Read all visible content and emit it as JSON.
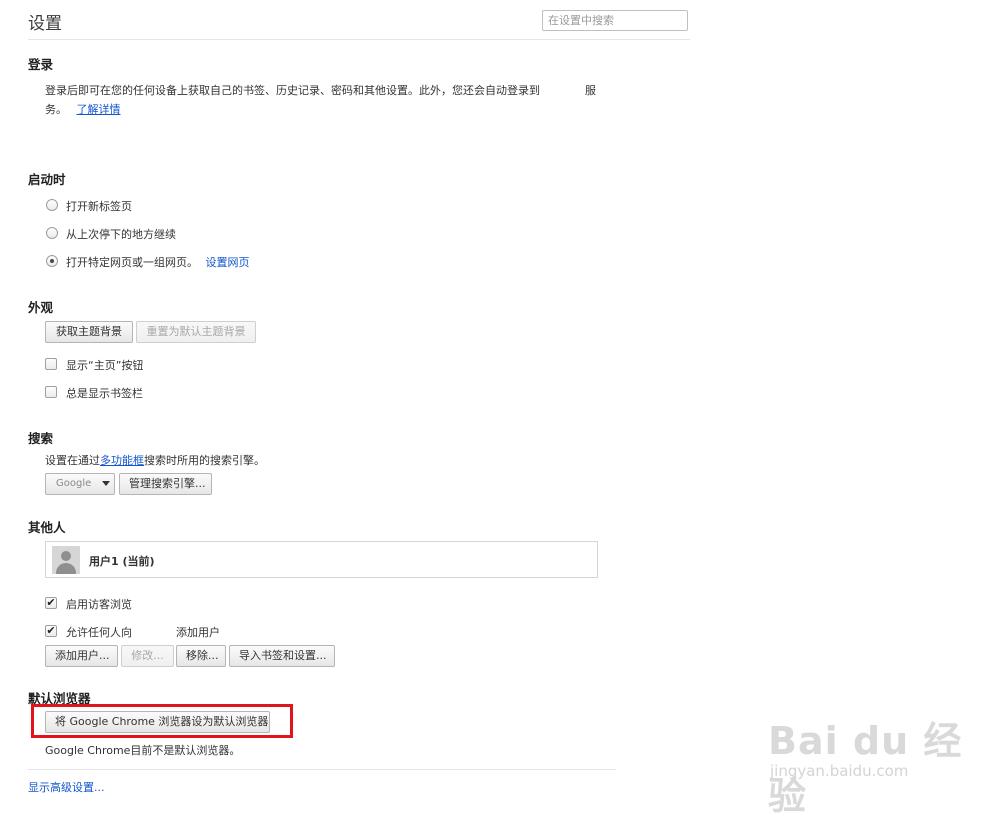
{
  "page": {
    "title": "设置",
    "search_placeholder": "在设置中搜索"
  },
  "signin": {
    "heading": "登录",
    "desc_line1": "登录后即可在您的任何设备上获取自己的书签、历史记录、密码和其他设置。此外，您还会自动登录到",
    "desc_line1_tail": "服",
    "desc_line2": "务。",
    "learn_more": "了解详情"
  },
  "startup": {
    "heading": "启动时",
    "options": [
      {
        "label": "打开新标签页",
        "checked": false
      },
      {
        "label": "从上次停下的地方继续",
        "checked": false
      },
      {
        "label": "打开特定网页或一组网页。",
        "checked": true
      }
    ],
    "set_pages_link": "设置网页"
  },
  "appearance": {
    "heading": "外观",
    "get_themes_button": "获取主题背景",
    "reset_theme_button": "重置为默认主题背景",
    "show_home_button": "显示“主页”按钮",
    "show_bookmarks_bar": "总是显示书签栏"
  },
  "search": {
    "heading": "搜索",
    "desc_prefix": "设置在通过",
    "omnibox_link": "多功能框",
    "desc_suffix": "搜索时所用的搜索引擎。",
    "engine_value": "Google",
    "manage_button": "管理搜索引擎..."
  },
  "people": {
    "heading": "其他人",
    "current_user": "用户1 (当前)",
    "enable_guest": "启用访客浏览",
    "allow_anyone": "允许任何人向",
    "add_user_text": "添加用户",
    "add_user_button": "添加用户...",
    "edit_button": "修改...",
    "remove_button": "移除...",
    "import_button": "导入书签和设置..."
  },
  "default_browser": {
    "heading": "默认浏览器",
    "make_default_button": "将 Google Chrome 浏览器设为默认浏览器",
    "status_text": "Google Chrome目前不是默认浏览器。"
  },
  "advanced": {
    "link": "显示高级设置..."
  },
  "watermark": {
    "logo": "Bai du 经验",
    "url": "jingyan.baidu.com"
  },
  "colors": {
    "link": "#1155cc",
    "highlight": "#e1141c"
  }
}
